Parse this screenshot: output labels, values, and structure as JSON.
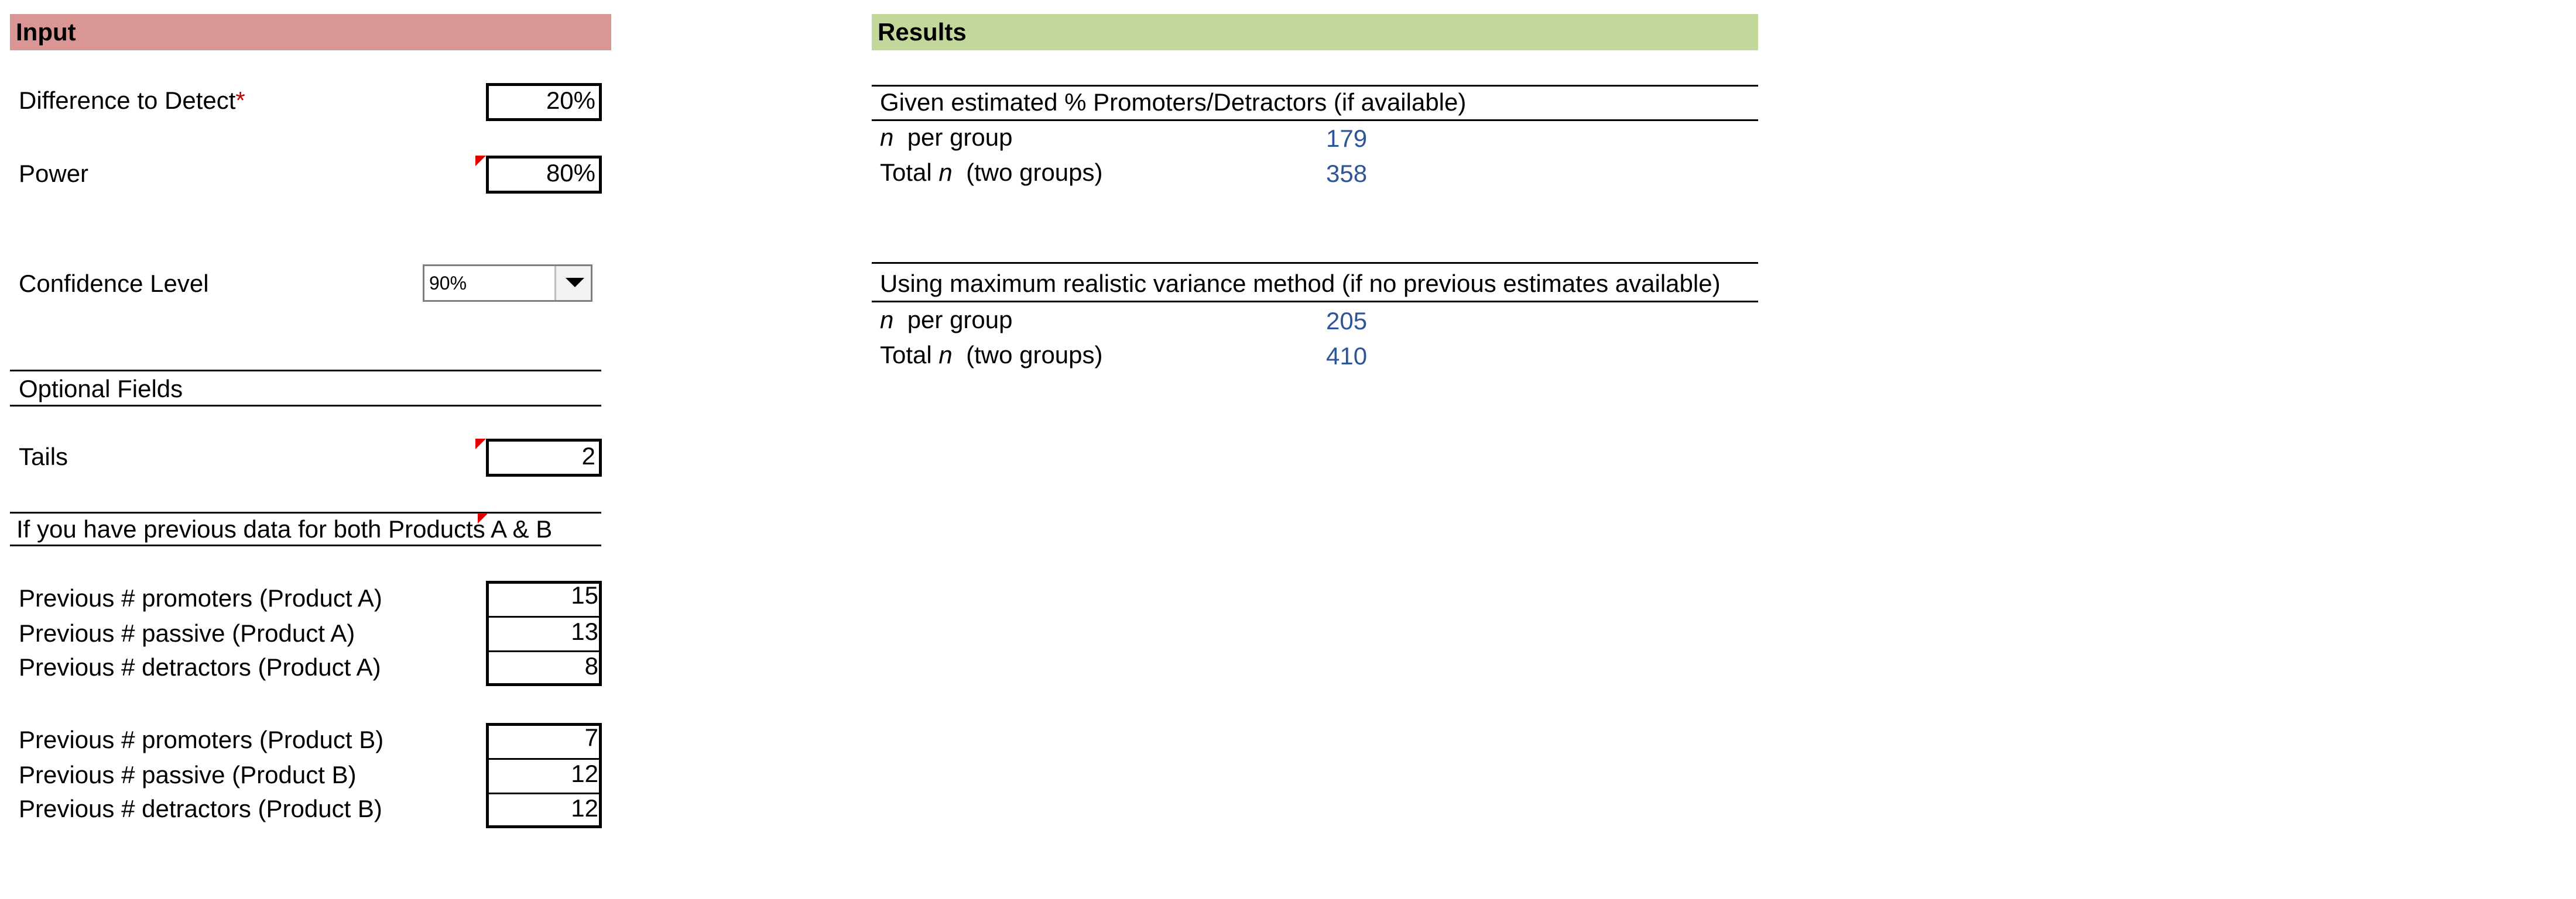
{
  "input": {
    "header": "Input",
    "difference_label": "Difference to Detect",
    "difference_req": "*",
    "difference_value": "20%",
    "power_label": "Power",
    "power_value": "80%",
    "confidence_label": "Confidence Level",
    "confidence_value": "90%",
    "optional_header": "Optional Fields",
    "tails_label": "Tails",
    "tails_value": "2",
    "previous_header": "If you have previous data for both Products A & B",
    "product_a": [
      {
        "label": "Previous # promoters (Product A)",
        "value": "15"
      },
      {
        "label": "Previous # passive (Product A)",
        "value": "13"
      },
      {
        "label": "Previous # detractors (Product A)",
        "value": "8"
      }
    ],
    "product_b": [
      {
        "label": "Previous # promoters (Product B)",
        "value": "7"
      },
      {
        "label": "Previous # passive (Product B)",
        "value": "12"
      },
      {
        "label": "Previous # detractors (Product B)",
        "value": "12"
      }
    ]
  },
  "results": {
    "header": "Results",
    "estimated": {
      "title": "Given estimated % Promoters/Detractors (if available)",
      "n_italic": "n",
      "per_group_label": "per group",
      "per_group_value": "179",
      "total_label_a": "Total",
      "total_label_b": "(two groups)",
      "total_value": "358"
    },
    "max_variance": {
      "title": "Using maximum realistic variance method (if no previous estimates available)",
      "n_italic": "n",
      "per_group_label": "per group",
      "per_group_value": "205",
      "total_label_a": "Total",
      "total_label_b": "(two groups)",
      "total_value": "410"
    }
  },
  "colors": {
    "input_header_bg": "#da9694",
    "results_header_bg": "#c4d79b",
    "result_value": "#2f5597",
    "required_marker": "#c00000",
    "comment_marker": "#e00000"
  }
}
